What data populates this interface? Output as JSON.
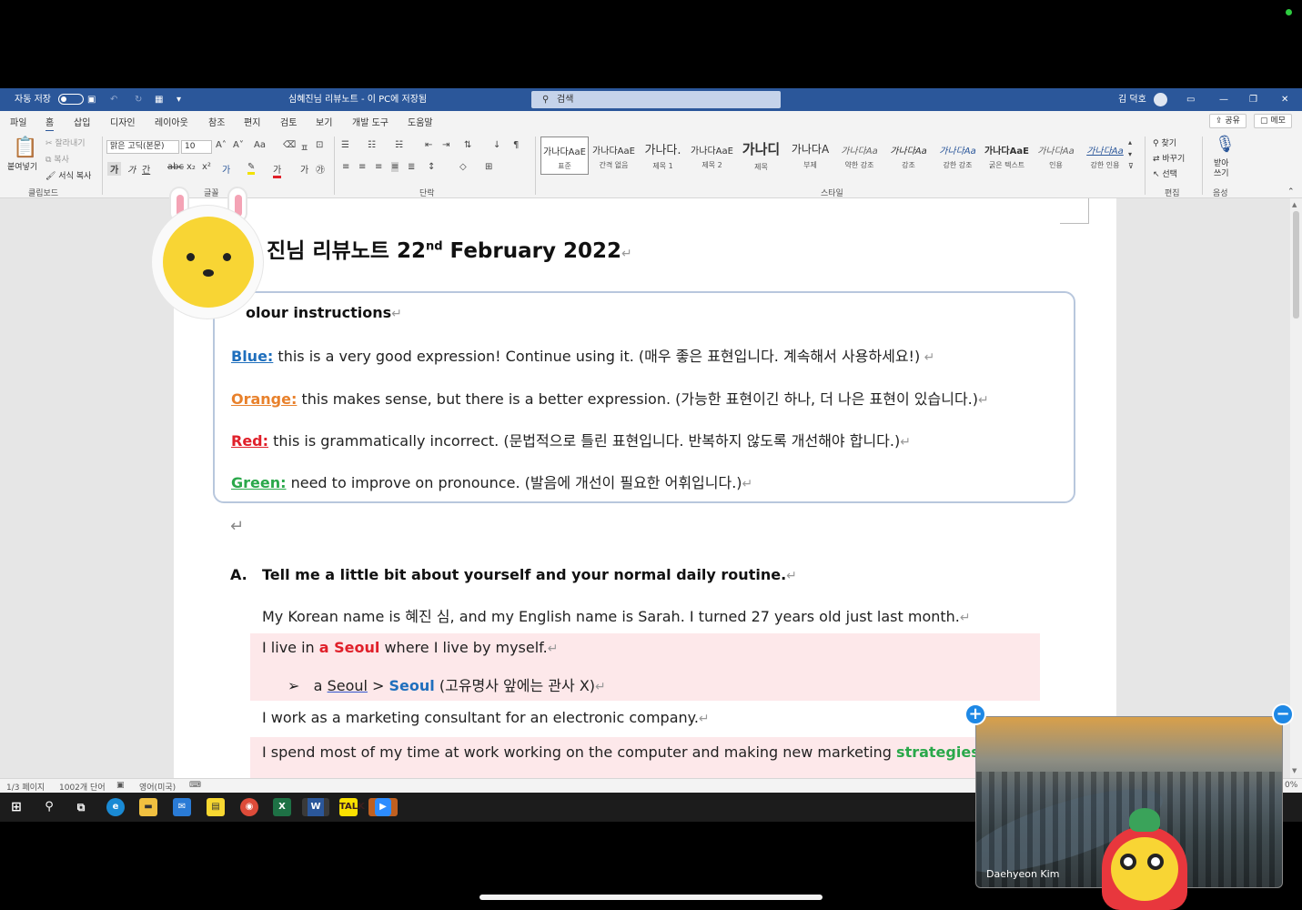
{
  "titlebar": {
    "autosave_label": "자동 저장",
    "autosave_state": "끔",
    "doc_title": "심혜진님 리뷰노트 - 이 PC에 저장됨",
    "search_placeholder": "검색",
    "user_name": "김 덕호"
  },
  "menu": {
    "tabs": [
      "파일",
      "홈",
      "삽입",
      "디자인",
      "레이아웃",
      "참조",
      "편지",
      "검토",
      "보기",
      "개발 도구",
      "도움말"
    ],
    "share_label": "공유",
    "memo_label": "메모"
  },
  "ribbon": {
    "clipboard": {
      "paste": "붙여넣기",
      "cut": "잘라내기",
      "copy": "복사",
      "format_painter": "서식 복사",
      "group": "클립보드"
    },
    "font": {
      "family": "맑은 고딕(본문)",
      "size": "10",
      "group": "글꼴"
    },
    "paragraph_group": "단락",
    "styles": {
      "group": "스타일",
      "items": [
        {
          "sample": "가나다AaE",
          "name": "표준"
        },
        {
          "sample": "가나다AaE",
          "name": "간격 없음"
        },
        {
          "sample": "가나다.",
          "name": "제목 1"
        },
        {
          "sample": "가나다AaE",
          "name": "제목 2"
        },
        {
          "sample": "가나디",
          "name": "제목"
        },
        {
          "sample": "가나다A",
          "name": "부제"
        },
        {
          "sample": "가나다Aa",
          "name": "약한 강조"
        },
        {
          "sample": "가나다Aa",
          "name": "강조"
        },
        {
          "sample": "가나다Aa",
          "name": "강한 강조"
        },
        {
          "sample": "가나다AaE",
          "name": "굵은 텍스트"
        },
        {
          "sample": "가나다Aa",
          "name": "인용"
        },
        {
          "sample": "가나다Aa",
          "name": "강한 인용"
        }
      ]
    },
    "editing": {
      "find": "찾기",
      "replace": "바꾸기",
      "select": "선택",
      "group": "편집"
    },
    "voice": {
      "dictate": "받아\n쓰기",
      "group": "음성"
    }
  },
  "document": {
    "title_visible": "진님 리뷰노트 22",
    "title_sup": "nd",
    "title_rest": " February 2022",
    "legend": {
      "heading": "olour instructions",
      "lines": [
        {
          "key": "Blue:",
          "color": "#1f6fbd",
          "text": " this is a very good expression! Continue using it. (매우 좋은 표현입니다. 계속해서 사용하세요!)"
        },
        {
          "key": "Orange:",
          "color": "#e8812c",
          "text": " this makes sense, but there is a better expression. (가능한 표현이긴 하나, 더 나은 표현이 있습니다.)"
        },
        {
          "key": "Red:",
          "color": "#e0202a",
          "text": " this is grammatically incorrect. (문법적으로 틀린 표현입니다. 반복하지 않도록 개선해야 합니다.)"
        },
        {
          "key": "Green:",
          "color": "#2aa84a",
          "text": " need to improve on pronounce. (발음에 개선이 필요한 어휘입니다.)"
        }
      ]
    },
    "question": {
      "label": "A.",
      "text": "Tell me a little bit about yourself and your normal daily routine."
    },
    "answers": {
      "line1": "My Korean name is 혜진 심, and my English name is Sarah. I turned 27 years old just last month.",
      "line2_pre": "I live in ",
      "line2_red": "a Seoul",
      "line2_post": " where I live by myself.",
      "correction_arrow": "➢",
      "correction_a": "a ",
      "correction_wrong": "Seoul",
      "correction_gt": " > ",
      "correction_right": "Seoul",
      "correction_note": " (고유명사 앞에는 관사 X)",
      "line3": "I work as a marketing consultant for an electronic company.",
      "line4_pre": "I spend most of my time at work working on the computer and making new marketing ",
      "line4_green": "strategies"
    }
  },
  "statusbar": {
    "page": "1/3 페이지",
    "words": "1002개 단어",
    "language": "영어(미국)",
    "zoom": "0%"
  },
  "video": {
    "participant": "Daehyeon Kim"
  }
}
